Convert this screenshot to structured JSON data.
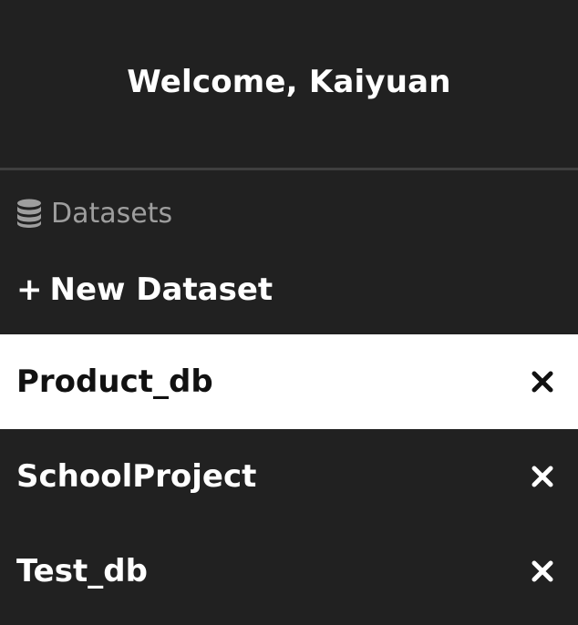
{
  "header": {
    "welcome_text": "Welcome, Kaiyuan"
  },
  "section": {
    "label": "Datasets",
    "icon": "database-icon"
  },
  "actions": {
    "new_dataset_plus": "+",
    "new_dataset_label": "New Dataset"
  },
  "datasets": [
    {
      "name": "Product_db",
      "active": true,
      "remove_icon": "close-icon"
    },
    {
      "name": "SchoolProject",
      "active": false,
      "remove_icon": "close-icon"
    },
    {
      "name": "Test_db",
      "active": false,
      "remove_icon": "close-icon"
    }
  ],
  "colors": {
    "background": "#212121",
    "active_row": "#ffffff",
    "muted_text": "#9e9e9e",
    "divider": "#3f3f3f"
  }
}
